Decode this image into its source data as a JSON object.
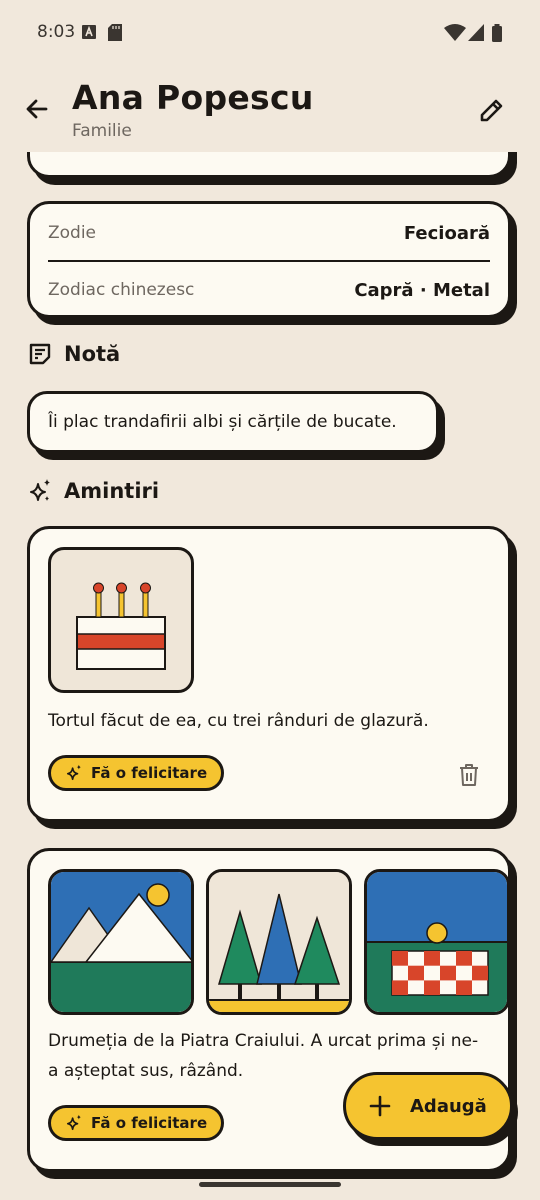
{
  "status": {
    "time": "8:03"
  },
  "header": {
    "title": "Ana Popescu",
    "subtitle": "Familie"
  },
  "zodiac": {
    "rows": [
      {
        "label": "Zodie",
        "value": "Fecioară"
      },
      {
        "label": "Zodiac chinezesc",
        "value": "Capră · Metal"
      }
    ]
  },
  "note": {
    "heading": "Notă",
    "text": "Îi plac trandafirii albi și cărțile de bucate."
  },
  "memories": {
    "heading": "Amintiri",
    "items": [
      {
        "text": "Tortul făcut de ea, cu trei rânduri de glazură.",
        "action": "Fă o felicitare"
      },
      {
        "text": "Drumeția de la Piatra Craiului. A urcat prima și ne-a așteptat sus, râzând.",
        "action": "Fă o felicitare"
      }
    ]
  },
  "fab": {
    "label": "Adaugă"
  },
  "icons": [
    "back-arrow-icon",
    "edit-pencil-icon",
    "note-icon",
    "sparkles-icon",
    "trash-icon",
    "plus-icon",
    "wifi-icon",
    "signal-icon",
    "battery-icon"
  ],
  "colors": {
    "background": "#f1e8dc",
    "card": "#fdfaf2",
    "accent": "#f5c430",
    "ink": "#1c1814"
  }
}
